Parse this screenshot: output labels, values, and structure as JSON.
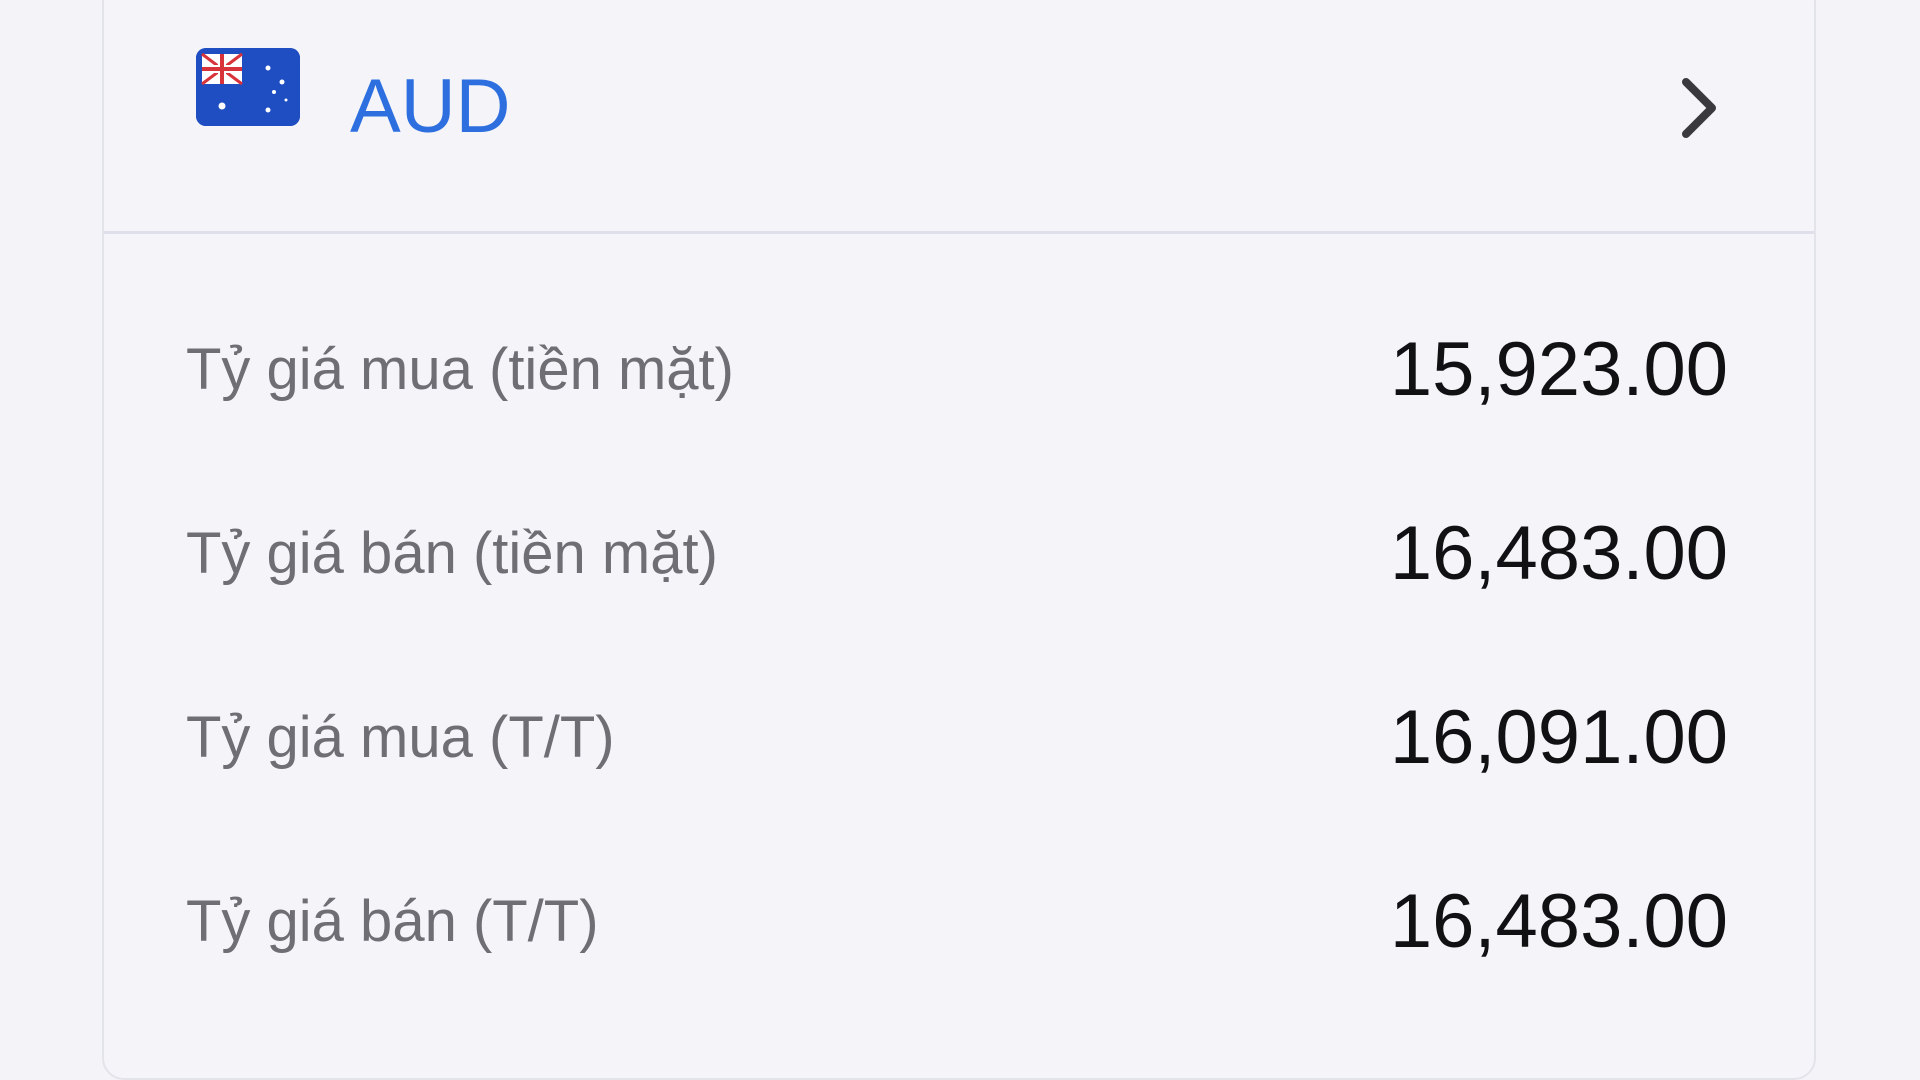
{
  "currency": {
    "code": "AUD",
    "flag_icon": "australia-flag-icon"
  },
  "rates": [
    {
      "label": "Tỷ giá mua (tiền mặt)",
      "value": "15,923.00"
    },
    {
      "label": "Tỷ giá bán (tiền mặt)",
      "value": "16,483.00"
    },
    {
      "label": "Tỷ giá mua (T/T)",
      "value": "16,091.00"
    },
    {
      "label": "Tỷ giá bán (T/T)",
      "value": "16,483.00"
    }
  ],
  "colors": {
    "accent": "#2e6fe0",
    "label": "#6e6e74",
    "value": "#111114",
    "background": "#f4f4f8",
    "divider": "#dedfe8"
  }
}
